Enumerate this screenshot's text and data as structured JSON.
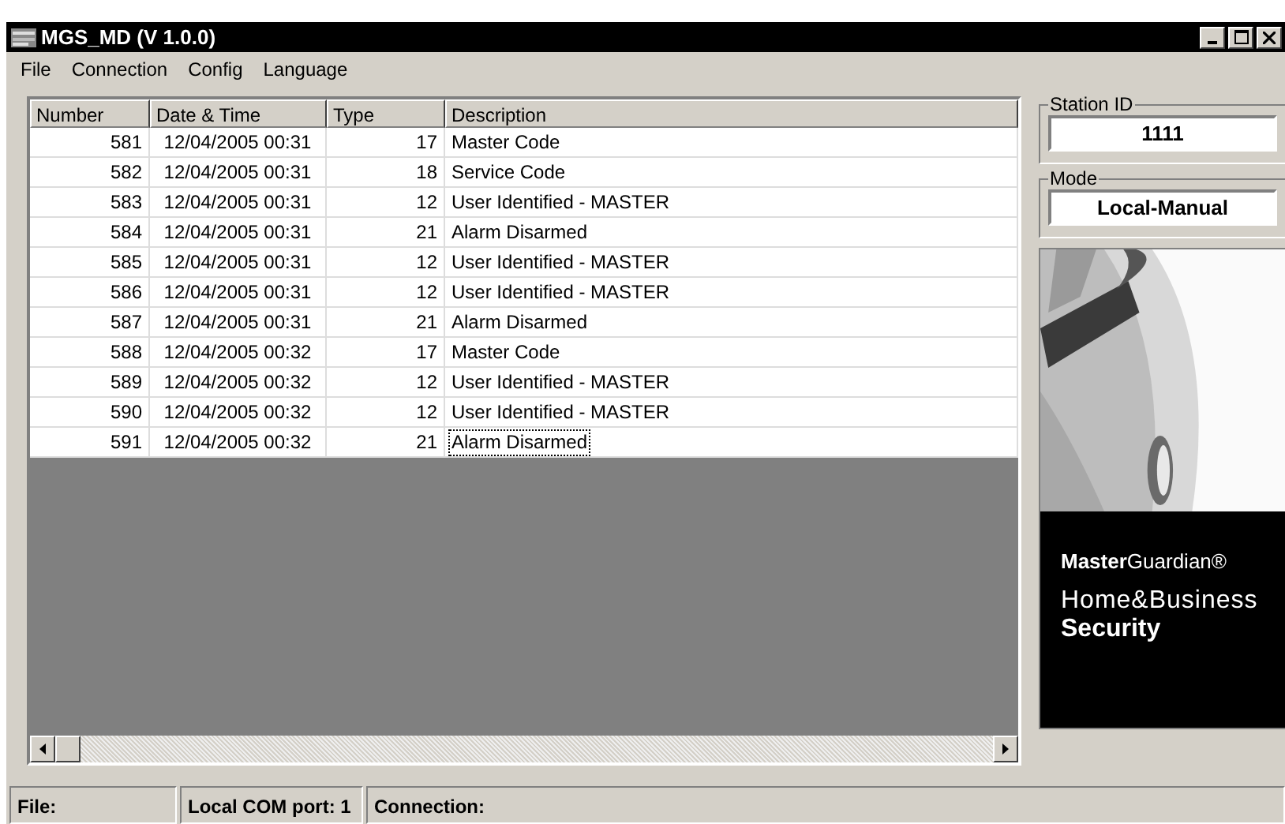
{
  "window": {
    "title": "MGS_MD (V 1.0.0)"
  },
  "menu": [
    "File",
    "Connection",
    "Config",
    "Language"
  ],
  "table": {
    "columns": [
      "Number",
      "Date & Time",
      "Type",
      "Description"
    ],
    "rows": [
      {
        "number": "581",
        "datetime": "12/04/2005 00:31",
        "type": "17",
        "description": "Master Code",
        "focused": false
      },
      {
        "number": "582",
        "datetime": "12/04/2005 00:31",
        "type": "18",
        "description": "Service Code",
        "focused": false
      },
      {
        "number": "583",
        "datetime": "12/04/2005 00:31",
        "type": "12",
        "description": "User Identified - MASTER",
        "focused": false
      },
      {
        "number": "584",
        "datetime": "12/04/2005 00:31",
        "type": "21",
        "description": "Alarm Disarmed",
        "focused": false
      },
      {
        "number": "585",
        "datetime": "12/04/2005 00:31",
        "type": "12",
        "description": "User Identified - MASTER",
        "focused": false
      },
      {
        "number": "586",
        "datetime": "12/04/2005 00:31",
        "type": "12",
        "description": "User Identified - MASTER",
        "focused": false
      },
      {
        "number": "587",
        "datetime": "12/04/2005 00:31",
        "type": "21",
        "description": "Alarm Disarmed",
        "focused": false
      },
      {
        "number": "588",
        "datetime": "12/04/2005 00:32",
        "type": "17",
        "description": "Master Code",
        "focused": false
      },
      {
        "number": "589",
        "datetime": "12/04/2005 00:32",
        "type": "12",
        "description": "User Identified - MASTER",
        "focused": false
      },
      {
        "number": "590",
        "datetime": "12/04/2005 00:32",
        "type": "12",
        "description": "User Identified - MASTER",
        "focused": false
      },
      {
        "number": "591",
        "datetime": "12/04/2005 00:32",
        "type": "21",
        "description": "Alarm Disarmed",
        "focused": true
      }
    ]
  },
  "station_id": {
    "label": "Station ID",
    "value": "1111"
  },
  "mode": {
    "label": "Mode",
    "value": "Local-Manual"
  },
  "banner": {
    "brand": "**Master**Guardian®",
    "line1": "Home&Business",
    "line2": "Security"
  },
  "status_bar": [
    "File:",
    "Local COM port: 1",
    "Connection:"
  ]
}
